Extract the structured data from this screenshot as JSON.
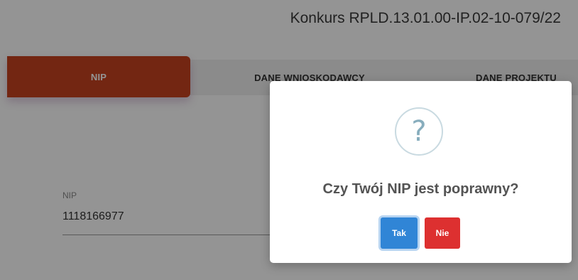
{
  "header": {
    "title": "Konkurs RPLD.13.01.00-IP.02-10-079/22"
  },
  "tabs": [
    {
      "label": "NIP",
      "active": true
    },
    {
      "label": "DANE WNIOSKODAWCY",
      "active": false
    },
    {
      "label": "DANE PROJEKTU",
      "active": false
    }
  ],
  "form": {
    "nip_label": "NIP",
    "nip_value": "1118166977"
  },
  "dialog": {
    "icon": "question-icon",
    "icon_glyph": "?",
    "title": "Czy Twój NIP jest poprawny?",
    "yes_label": "Tak",
    "no_label": "Nie"
  },
  "colors": {
    "active_tab": "#c7431f",
    "confirm_button": "#3085d6",
    "cancel_button": "#dd3030"
  }
}
